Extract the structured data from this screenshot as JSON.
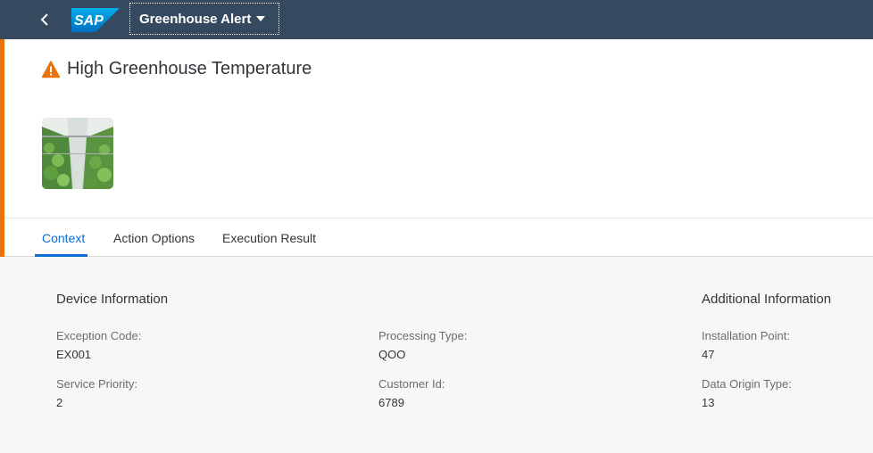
{
  "shell": {
    "app_title": "Greenhouse Alert",
    "logo_text": "SAP"
  },
  "header": {
    "title": "High Greenhouse Temperature"
  },
  "tabs": [
    {
      "label": "Context",
      "active": true
    },
    {
      "label": "Action Options",
      "active": false
    },
    {
      "label": "Execution Result",
      "active": false
    }
  ],
  "context": {
    "device_information": {
      "title": "Device Information",
      "exception_code": {
        "label": "Exception Code:",
        "value": "EX001"
      },
      "service_priority": {
        "label": "Service Priority:",
        "value": "2"
      },
      "processing_type": {
        "label": "Processing Type:",
        "value": "QOO"
      },
      "customer_id": {
        "label": "Customer Id:",
        "value": "6789"
      }
    },
    "additional_information": {
      "title": "Additional Information",
      "installation_point": {
        "label": "Installation Point:",
        "value": "47"
      },
      "data_origin_type": {
        "label": "Data Origin Type:",
        "value": "13"
      }
    }
  },
  "colors": {
    "shell": "#354a5f",
    "accent_warning": "#e9730c",
    "active_tab": "#0a6ed1"
  },
  "icons": [
    "back-arrow-icon",
    "dropdown-caret-icon",
    "warning-icon"
  ]
}
